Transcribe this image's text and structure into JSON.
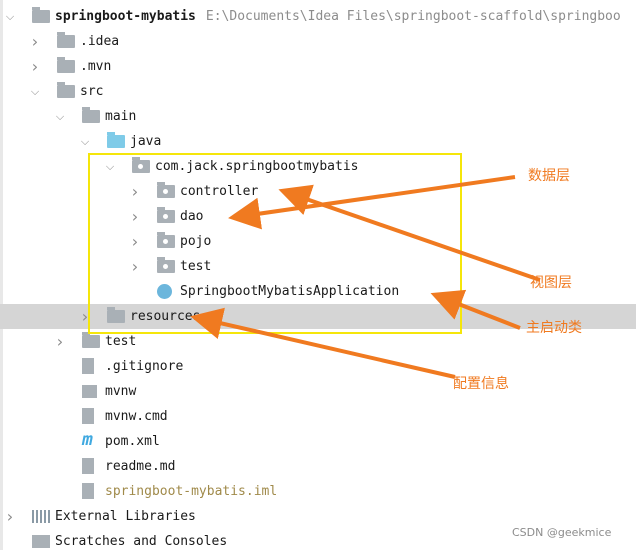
{
  "tree": [
    {
      "label": "springboot-mybatis",
      "path": "E:\\Documents\\Idea Files\\springboot-scaffold\\springboo",
      "level": 0,
      "expand": "open",
      "icon": "module-folder-icon"
    },
    {
      "label": ".idea",
      "level": 1,
      "expand": "closed",
      "icon": "folder-icon"
    },
    {
      "label": ".mvn",
      "level": 1,
      "expand": "closed",
      "icon": "folder-icon"
    },
    {
      "label": "src",
      "level": 1,
      "expand": "open",
      "icon": "folder-icon"
    },
    {
      "label": "main",
      "level": 2,
      "expand": "open",
      "icon": "folder-icon"
    },
    {
      "label": "java",
      "level": 3,
      "expand": "open",
      "icon": "source-folder-icon"
    },
    {
      "label": "com.jack.springbootmybatis",
      "level": 4,
      "expand": "open",
      "icon": "package-icon"
    },
    {
      "label": "controller",
      "level": 5,
      "expand": "closed",
      "icon": "package-icon"
    },
    {
      "label": "dao",
      "level": 5,
      "expand": "closed",
      "icon": "package-icon"
    },
    {
      "label": "pojo",
      "level": 5,
      "expand": "closed",
      "icon": "package-icon"
    },
    {
      "label": "test",
      "level": 5,
      "expand": "closed",
      "icon": "package-icon"
    },
    {
      "label": "SpringbootMybatisApplication",
      "level": 5,
      "expand": "none",
      "icon": "spring-boot-class-icon"
    },
    {
      "label": "resources",
      "level": 3,
      "expand": "closed",
      "icon": "resources-folder-icon",
      "selected": true
    },
    {
      "label": "test",
      "level": 2,
      "expand": "closed",
      "icon": "folder-icon"
    },
    {
      "label": ".gitignore",
      "level": 2,
      "expand": "none",
      "icon": "gitignore-file-icon"
    },
    {
      "label": "mvnw",
      "level": 2,
      "expand": "none",
      "icon": "shell-file-icon"
    },
    {
      "label": "mvnw.cmd",
      "level": 2,
      "expand": "none",
      "icon": "text-file-icon"
    },
    {
      "label": "pom.xml",
      "level": 2,
      "expand": "none",
      "icon": "maven-icon"
    },
    {
      "label": "readme.md",
      "level": 2,
      "expand": "none",
      "icon": "markdown-file-icon"
    },
    {
      "label": "springboot-mybatis.iml",
      "level": 2,
      "expand": "none",
      "icon": "iml-file-icon",
      "muted": true
    },
    {
      "label": "External Libraries",
      "level": 0,
      "expand": "closed",
      "icon": "libraries-icon"
    },
    {
      "label": "Scratches and Consoles",
      "level": 0,
      "expand": "none",
      "icon": "scratches-icon"
    }
  ],
  "annotations": {
    "data_layer": "数据层",
    "view_layer": "视图层",
    "main_class": "主启动类",
    "config": "配置信息"
  },
  "watermark": "CSDN @geekmice",
  "colors": {
    "arrow": "#f07a20",
    "highlight_box": "#f5e60a",
    "selection": "#d5d5d5"
  }
}
